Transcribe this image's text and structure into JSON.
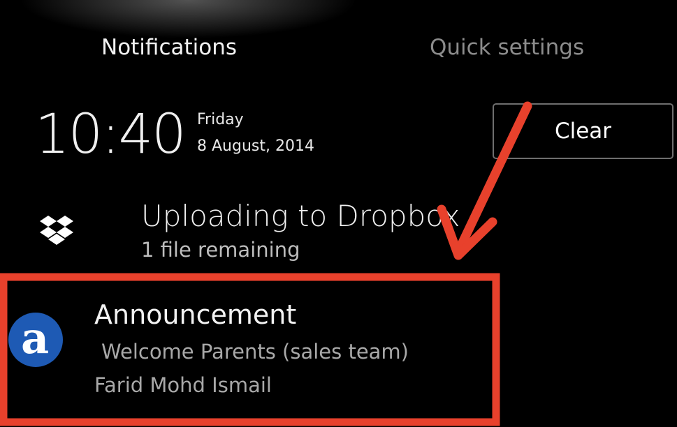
{
  "tabs": {
    "notifications": "Notifications",
    "quick_settings": "Quick settings"
  },
  "header": {
    "time": "10:40",
    "day": "Friday",
    "date": "8 August, 2014",
    "clear_label": "Clear"
  },
  "notifications": [
    {
      "icon": "dropbox-icon",
      "title": "Uploading to Dropbox",
      "subtitle": "1 file remaining"
    },
    {
      "icon": "announcement-app-icon",
      "icon_letter": "a",
      "icon_color": "#1e5ab4",
      "title": "Announcement",
      "line1": "Welcome Parents (sales team)",
      "line2": "Farid Mohd Ismail"
    }
  ],
  "annotation": {
    "color": "#e8412c"
  }
}
